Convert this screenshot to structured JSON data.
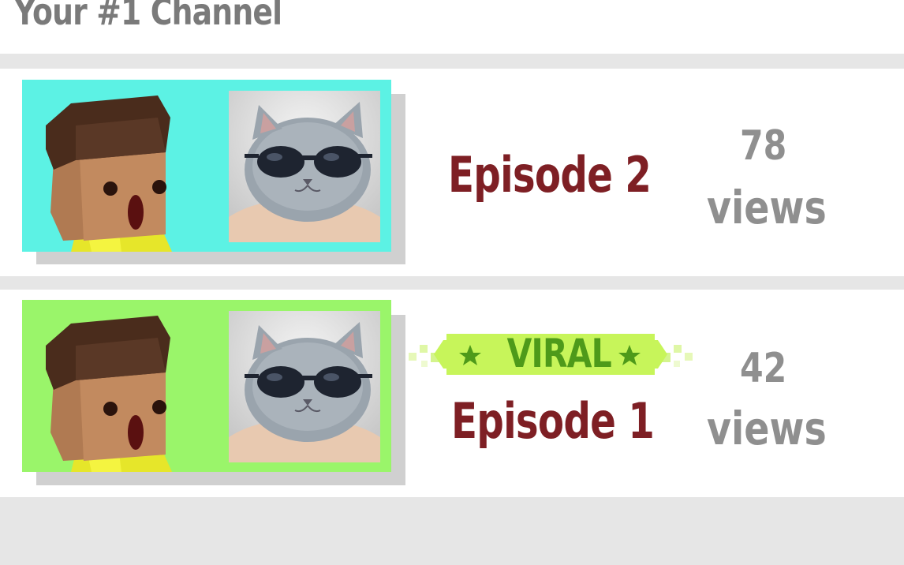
{
  "channel": {
    "title": "Your #1 Channel"
  },
  "episodes": [
    {
      "title": "Episode 2",
      "views_count": "78",
      "views_label": "views",
      "viral": false,
      "thumbnail_bg": "#5cf2e4"
    },
    {
      "title": "Episode 1",
      "views_count": "42",
      "views_label": "views",
      "viral": true,
      "badge_label": "VIRAL",
      "thumbnail_bg": "#9af56a"
    }
  ],
  "colors": {
    "episode_title": "#7e1f24",
    "views_text": "#8f8f8f",
    "header_text": "#7a7a7a",
    "viral_text": "#4e9a1a",
    "viral_bg": "#c7f55a"
  },
  "icons": {
    "avatar": "blocky-character-avatar",
    "cat": "cat-with-sunglasses-photo",
    "star": "star-icon"
  }
}
